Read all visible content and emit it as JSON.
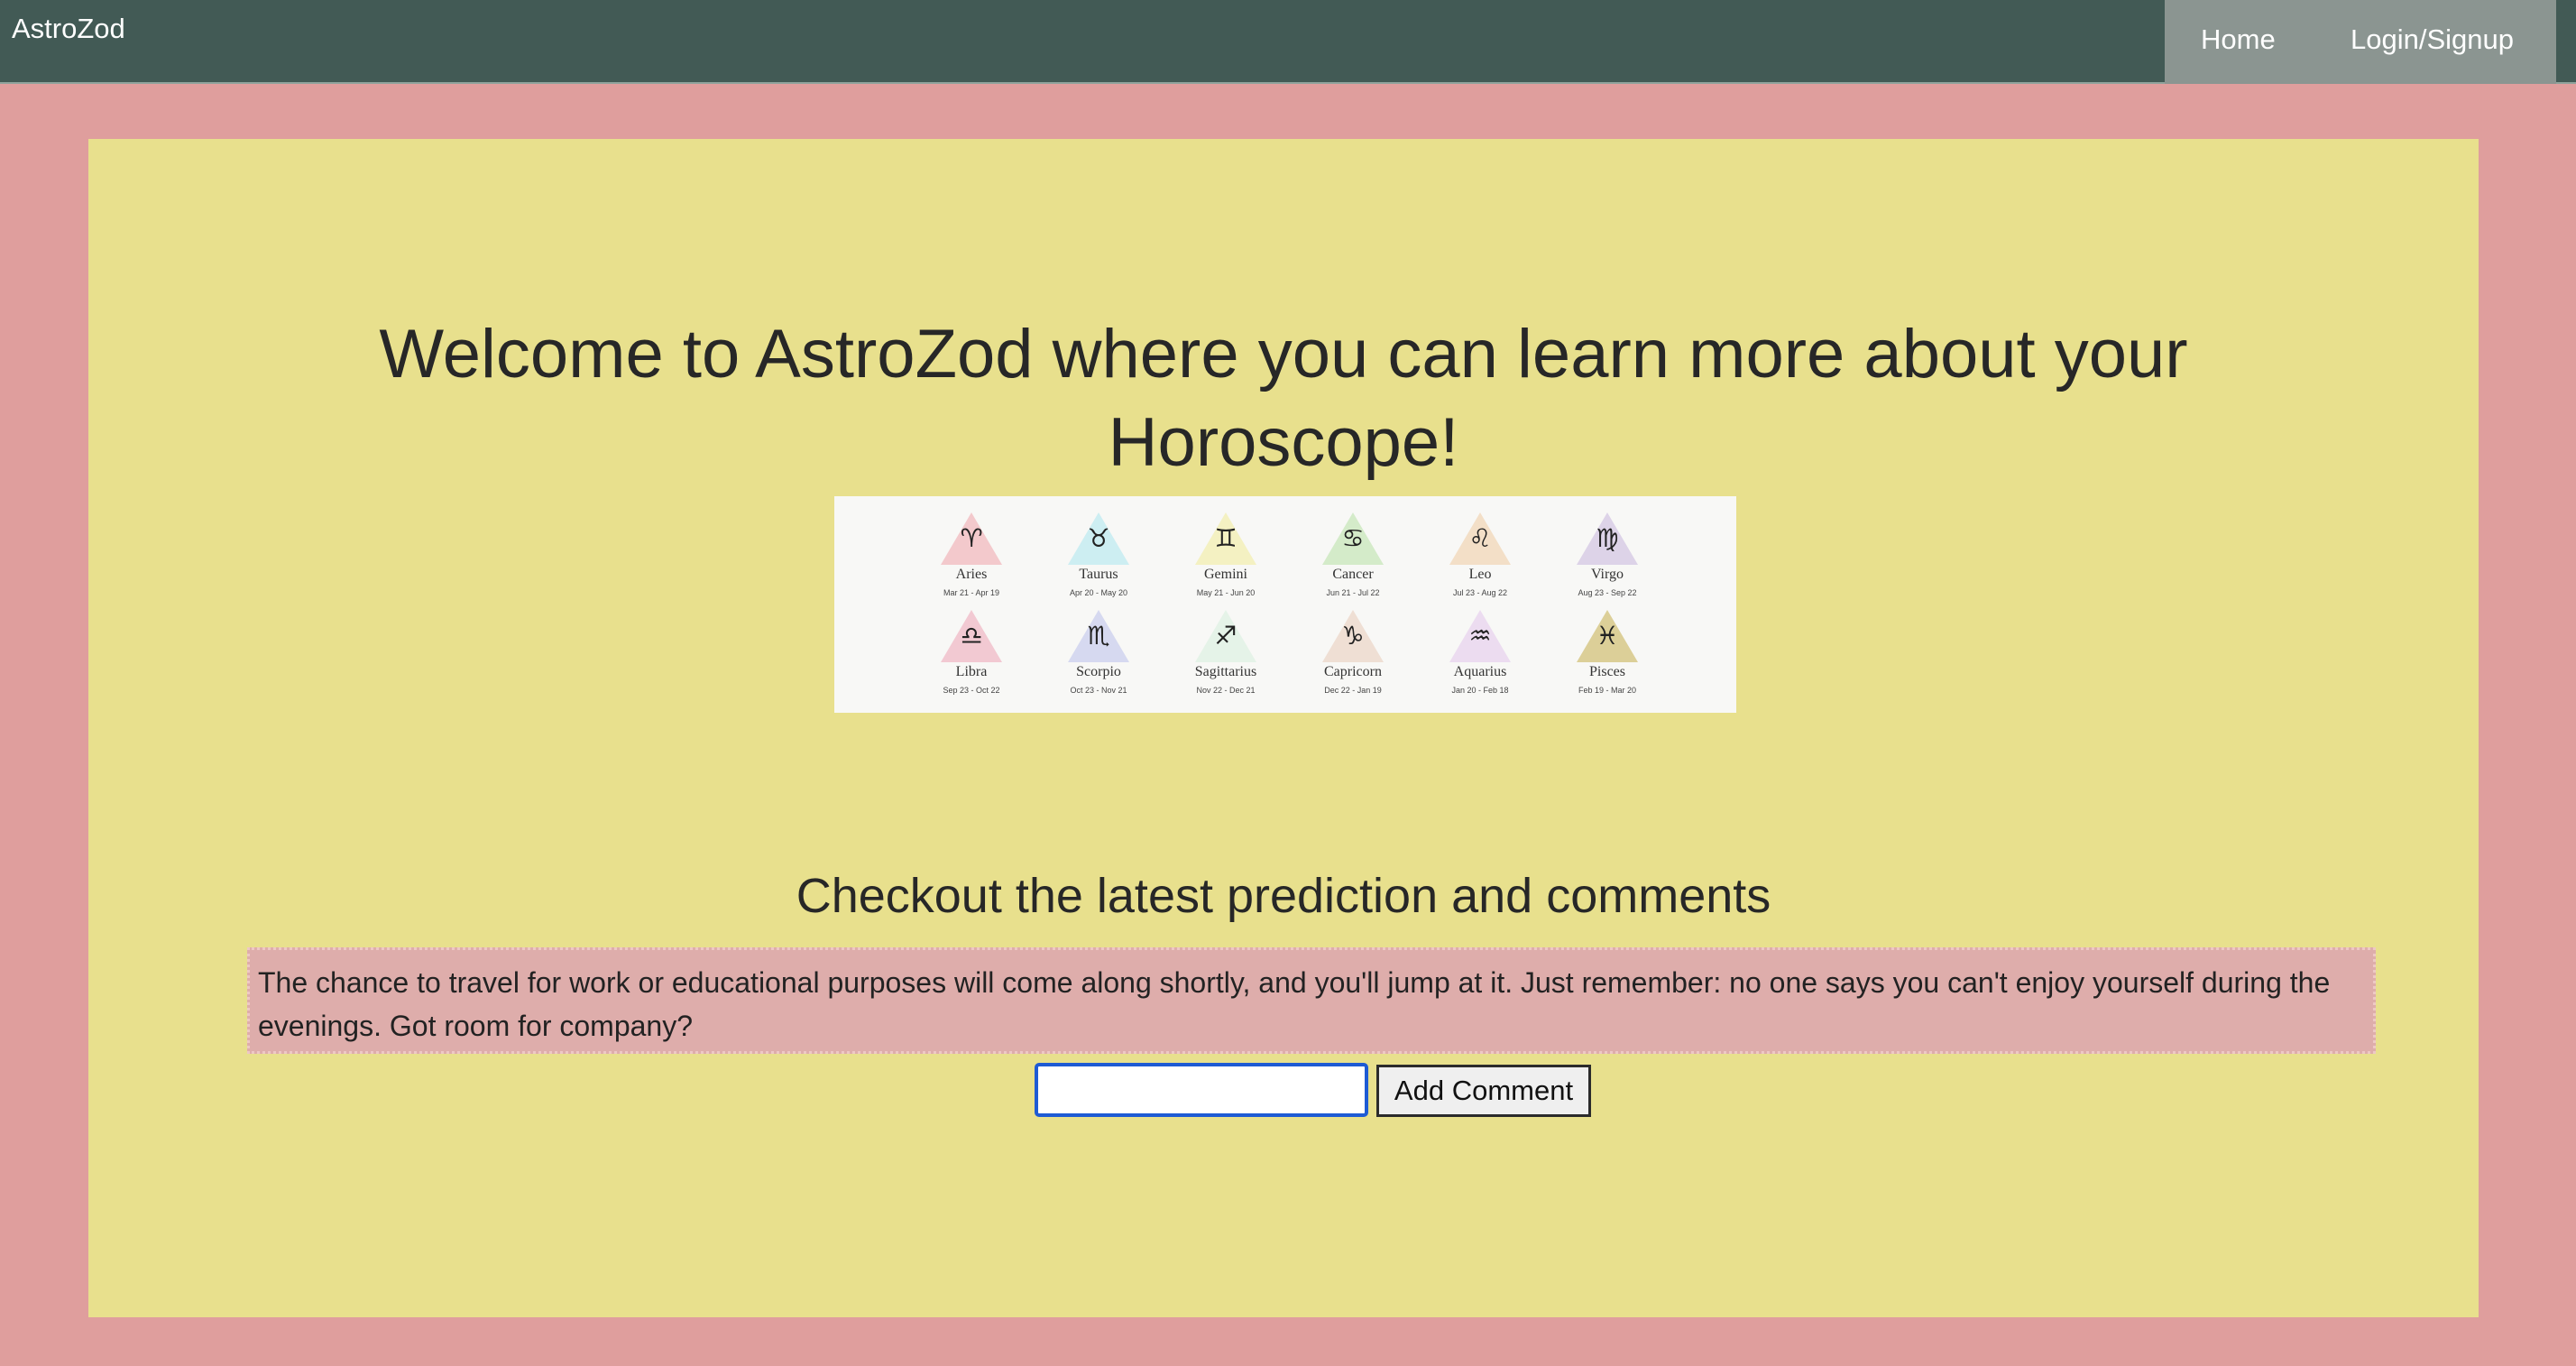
{
  "navbar": {
    "brand": "AstroZod",
    "links": [
      {
        "label": "Home"
      },
      {
        "label": "Login/Signup"
      }
    ]
  },
  "hero": {
    "title_line1": "Welcome to AstroZod where you can learn more about your",
    "title_line2": "Horoscope!"
  },
  "zodiac": {
    "signs": [
      {
        "name": "Aries",
        "dates": "Mar 21 - Apr 19",
        "glyph": "♈",
        "color": "#f3c9cc"
      },
      {
        "name": "Taurus",
        "dates": "Apr 20 - May 20",
        "glyph": "♉",
        "color": "#cdeef2"
      },
      {
        "name": "Gemini",
        "dates": "May 21 - Jun 20",
        "glyph": "♊",
        "color": "#f4f1c2"
      },
      {
        "name": "Cancer",
        "dates": "Jun 21 - Jul 22",
        "glyph": "♋",
        "color": "#d4ebc9"
      },
      {
        "name": "Leo",
        "dates": "Jul 23 - Aug 22",
        "glyph": "♌",
        "color": "#f3dfc7"
      },
      {
        "name": "Virgo",
        "dates": "Aug 23 - Sep 22",
        "glyph": "♍",
        "color": "#ddd3e8"
      },
      {
        "name": "Libra",
        "dates": "Sep 23 - Oct 22",
        "glyph": "♎",
        "color": "#f2c9d2"
      },
      {
        "name": "Scorpio",
        "dates": "Oct 23 - Nov 21",
        "glyph": "♏",
        "color": "#d6d9f0"
      },
      {
        "name": "Sagittarius",
        "dates": "Nov 22 - Dec 21",
        "glyph": "♐",
        "color": "#e5f3e8"
      },
      {
        "name": "Capricorn",
        "dates": "Dec 22 - Jan 19",
        "glyph": "♑",
        "color": "#efdfd4"
      },
      {
        "name": "Aquarius",
        "dates": "Jan 20 - Feb 18",
        "glyph": "♒",
        "color": "#ecdcf0"
      },
      {
        "name": "Pisces",
        "dates": "Feb 19 - Mar 20",
        "glyph": "♓",
        "color": "#dccf98"
      }
    ]
  },
  "section": {
    "title": "Checkout the latest prediction and comments"
  },
  "prediction": {
    "text": "The chance to travel for work or educational purposes will come along shortly, and you'll jump at it. Just remember: no one says you can't enjoy yourself during the evenings. Got room for company?"
  },
  "comment_form": {
    "input_value": "",
    "button_label": "Add Comment"
  },
  "colors": {
    "page_background": "#df9e9d",
    "navbar": "#425a55",
    "nav_links_background": "#8b9591",
    "panel": "#e8e08d",
    "prediction_box": "#deadab",
    "input_focus_border": "#1e5bd4"
  }
}
